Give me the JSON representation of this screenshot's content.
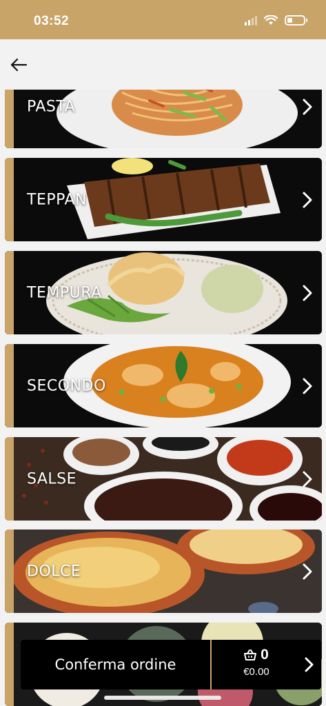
{
  "status_bar": {
    "time": "03:52",
    "icons": [
      "signal-icon",
      "wifi-icon",
      "battery-icon"
    ]
  },
  "nav": {
    "back_icon": "arrow-left-icon"
  },
  "categories": [
    {
      "label": "PASTA",
      "image": "pasta-dish"
    },
    {
      "label": "TEPPAN",
      "image": "grilled-meat-dish"
    },
    {
      "label": "TEMPURA",
      "image": "tempura-dish"
    },
    {
      "label": "SECONDO",
      "image": "curry-dish"
    },
    {
      "label": "SALSE",
      "image": "sauces"
    },
    {
      "label": "DOLCE",
      "image": "creme-brulee"
    },
    {
      "label": "",
      "image": "dessert-balls"
    }
  ],
  "order_bar": {
    "confirm_label": "Conferma ordine",
    "cart_count": "0",
    "cart_total": "€0.00",
    "cart_icon": "basket-icon"
  },
  "colors": {
    "accent": "#c9a468",
    "background": "#f2f2f2",
    "card_bg": "#111111"
  }
}
